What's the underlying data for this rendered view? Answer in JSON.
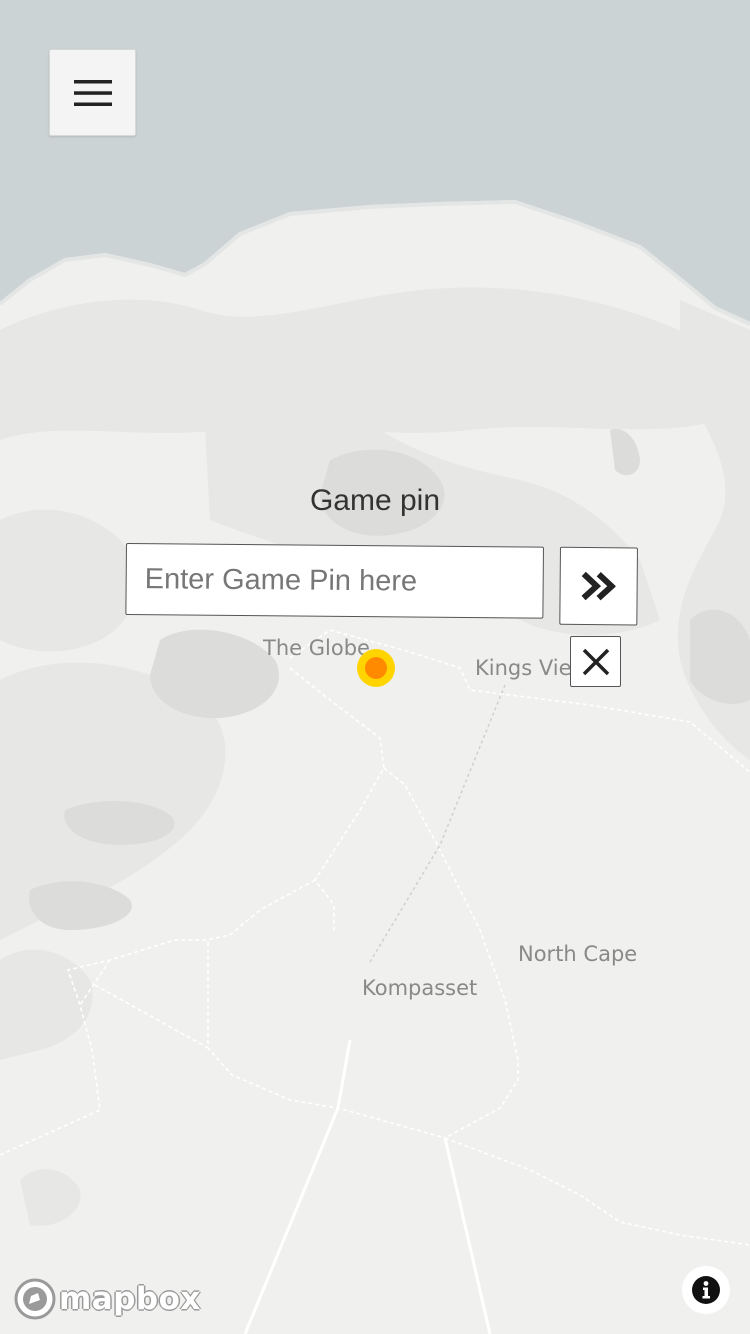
{
  "map": {
    "colors": {
      "water": "#ccd3d4",
      "land": "#f0f0ee",
      "terrain": "#e6e6e4",
      "road": "#ffffff",
      "path": "#d0d0d0"
    },
    "places": [
      {
        "name": "The Globe"
      },
      {
        "name": "Kings Vie"
      },
      {
        "name": "North Cape"
      },
      {
        "name": "Kompasset"
      }
    ],
    "location_marker": {
      "color": "#ff8a00",
      "halo": "#ffd400"
    }
  },
  "menu": {
    "icon": "hamburger-menu-icon"
  },
  "game_pin": {
    "title": "Game pin",
    "input_placeholder": "Enter Game Pin here",
    "input_value": "",
    "submit_icon": "double-chevron-right-icon",
    "close_icon": "close-icon"
  },
  "attribution": {
    "logo_text": "mapbox",
    "info_icon": "info-icon"
  }
}
